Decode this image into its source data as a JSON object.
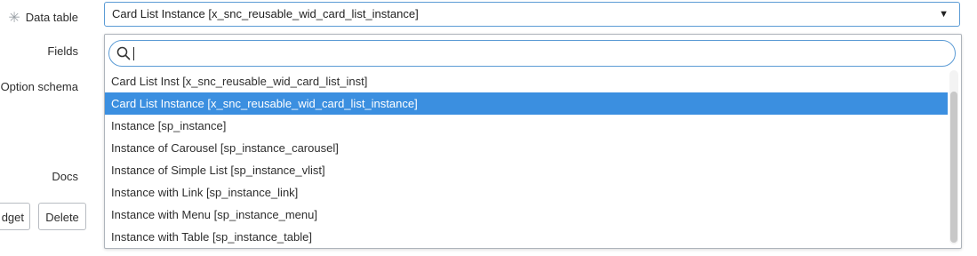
{
  "form": {
    "data_table_label": "Data table",
    "fields_label": "Fields",
    "option_schema_label": "Option schema",
    "docs_label": "Docs",
    "required_icon": "asterisk-icon"
  },
  "select": {
    "value": "Card List Instance [x_snc_reusable_wid_card_list_instance]",
    "caret_icon": "▼"
  },
  "dropdown": {
    "search_value": "",
    "options": [
      "Card List Inst [x_snc_reusable_wid_card_list_inst]",
      "Card List Instance [x_snc_reusable_wid_card_list_instance]",
      "Instance [sp_instance]",
      "Instance of Carousel [sp_instance_carousel]",
      "Instance of Simple List [sp_instance_vlist]",
      "Instance with Link [sp_instance_link]",
      "Instance with Menu [sp_instance_menu]",
      "Instance with Table [sp_instance_table]"
    ],
    "selected_index": 1
  },
  "buttons": {
    "widget_label": "dget",
    "delete_label": "Delete"
  },
  "colors": {
    "accent": "#3b8fe0",
    "focus_border": "#5b9bd5"
  }
}
